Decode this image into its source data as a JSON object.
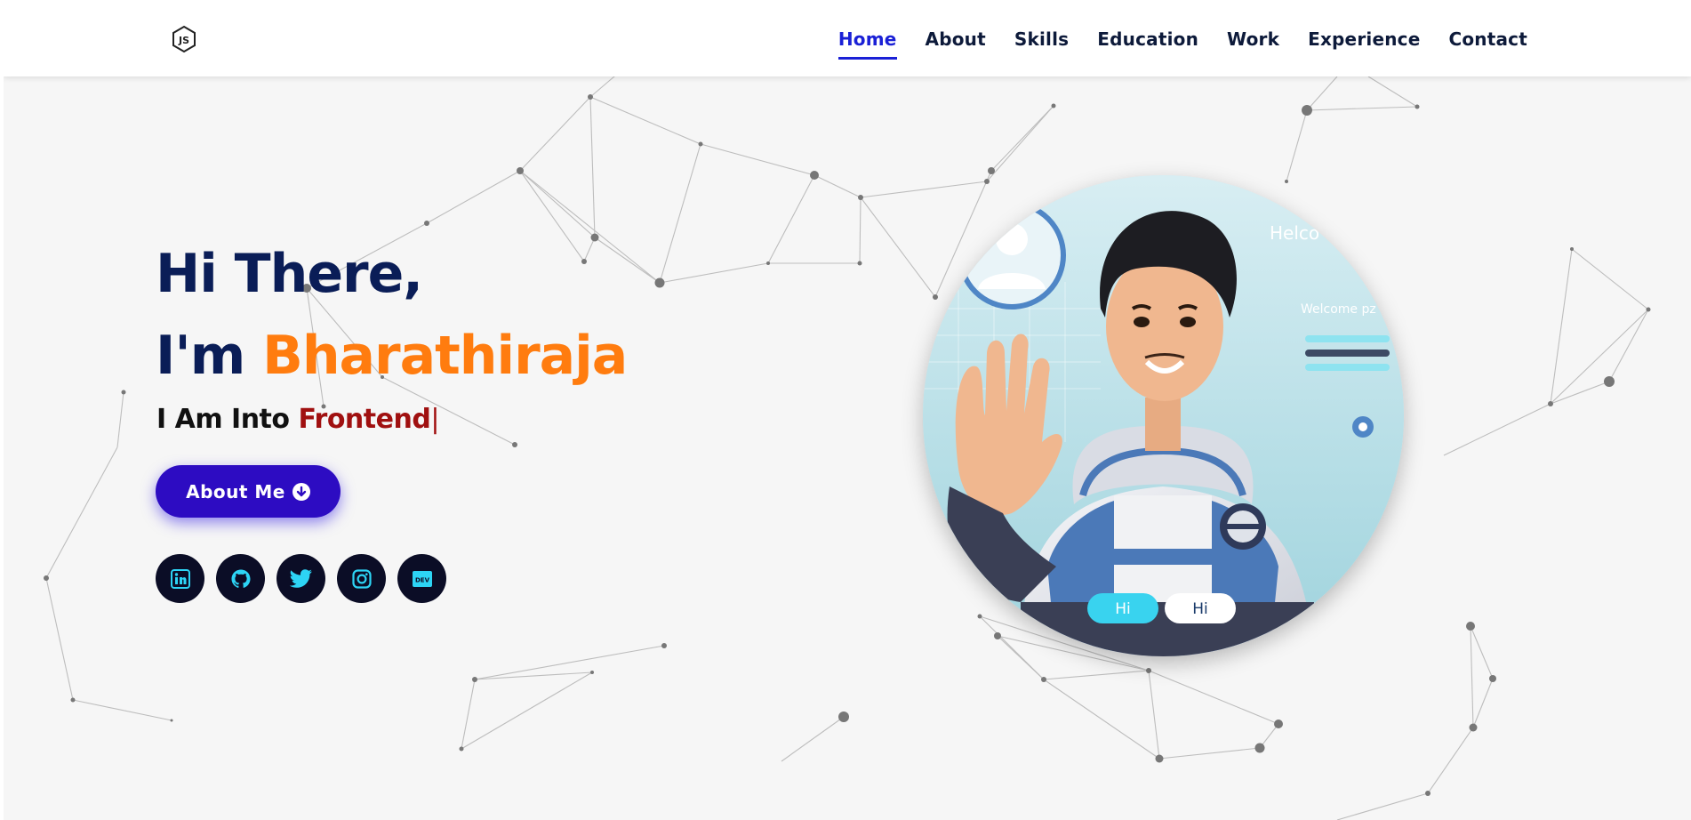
{
  "nav": {
    "logo": "nodejs-logo",
    "items": [
      "Home",
      "About",
      "Skills",
      "Education",
      "Work",
      "Experience",
      "Contact"
    ],
    "active": "Home"
  },
  "hero": {
    "line1": "Hi There,",
    "line2_prefix": "I'm ",
    "name": "Bharathiraja",
    "into_prefix": "I Am Into ",
    "typed": "Frontend",
    "cursor": "|",
    "button_label": "About Me",
    "button_icon": "arrow-down-circle-icon"
  },
  "socials": [
    "linkedin-icon",
    "github-icon",
    "twitter-icon",
    "instagram-icon",
    "dev-icon"
  ],
  "avatar": {
    "image": "cartoon boy waving in hoodie",
    "screen_text": [
      "Helco",
      "Welcome pz"
    ],
    "pill_labels": [
      "Hi",
      "Hi"
    ]
  },
  "colors": {
    "navy": "#0a1d57",
    "accent_orange": "#ff7c0f",
    "active_nav": "#1a20d6",
    "button": "#2d0cc2",
    "typed_red": "#a01010",
    "social_bg": "#0b0d26",
    "social_icon": "#2dd4f5"
  }
}
